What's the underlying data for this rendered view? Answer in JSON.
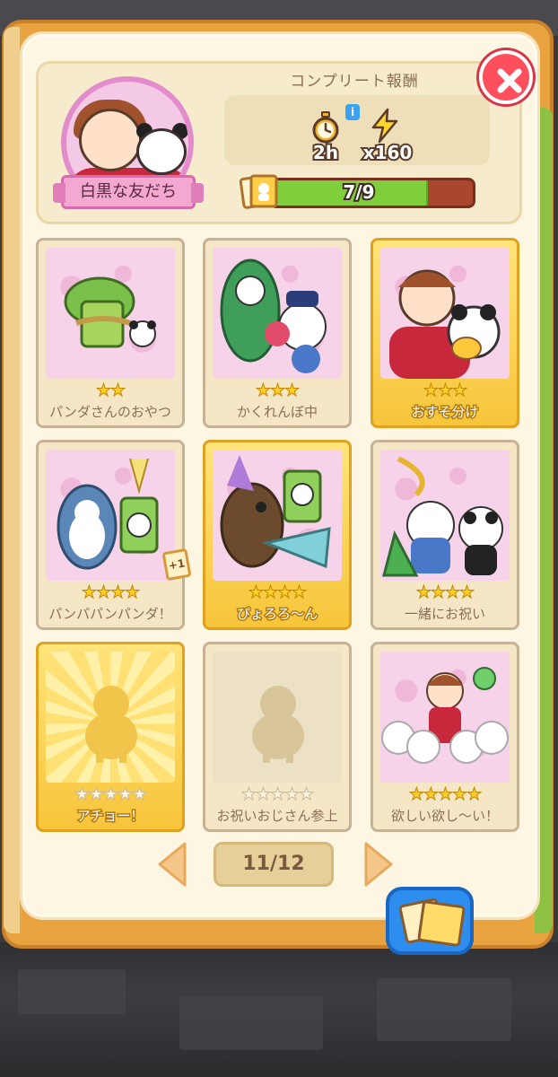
{
  "set": {
    "title": "白黒な友だち",
    "reward_heading": "コンプリート報酬",
    "reward_time": "2h",
    "reward_amount": "x160",
    "info_label": "i",
    "progress_text": "7/9",
    "progress_value": 0.778
  },
  "cards": [
    {
      "name": "パンダさんのおやつ",
      "stars": 2,
      "owned": true,
      "gold": false,
      "art": "bamboo-panda"
    },
    {
      "name": "かくれんぼ中",
      "stars": 3,
      "owned": true,
      "gold": false,
      "art": "hide-and-seek"
    },
    {
      "name": "おすそ分け",
      "stars": 3,
      "owned": true,
      "gold": true,
      "art": "sharing"
    },
    {
      "name": "パンパパンパンダ！",
      "stars": 4,
      "owned": true,
      "gold": false,
      "art": "shark-panda",
      "badge": "+1"
    },
    {
      "name": "ぴょろろ～ん",
      "stars": 4,
      "owned": true,
      "gold": true,
      "art": "kiwi-party"
    },
    {
      "name": "一緒にお祝い",
      "stars": 4,
      "owned": true,
      "gold": false,
      "art": "celebrate"
    },
    {
      "name": "アチョー！",
      "stars": 5,
      "owned": false,
      "gold": true,
      "art": "locked"
    },
    {
      "name": "お祝いおじさん参上",
      "stars": 5,
      "owned": false,
      "gold": false,
      "art": "locked"
    },
    {
      "name": "欲しい欲し～い！",
      "stars": 5,
      "owned": true,
      "gold": false,
      "art": "crowd"
    }
  ],
  "pagination": {
    "label": "11/12"
  },
  "colors": {
    "accent": "#7fcf3d",
    "close": "#ff4e5c",
    "gold": "#f7c53a",
    "pink": "#f6d3e8"
  }
}
